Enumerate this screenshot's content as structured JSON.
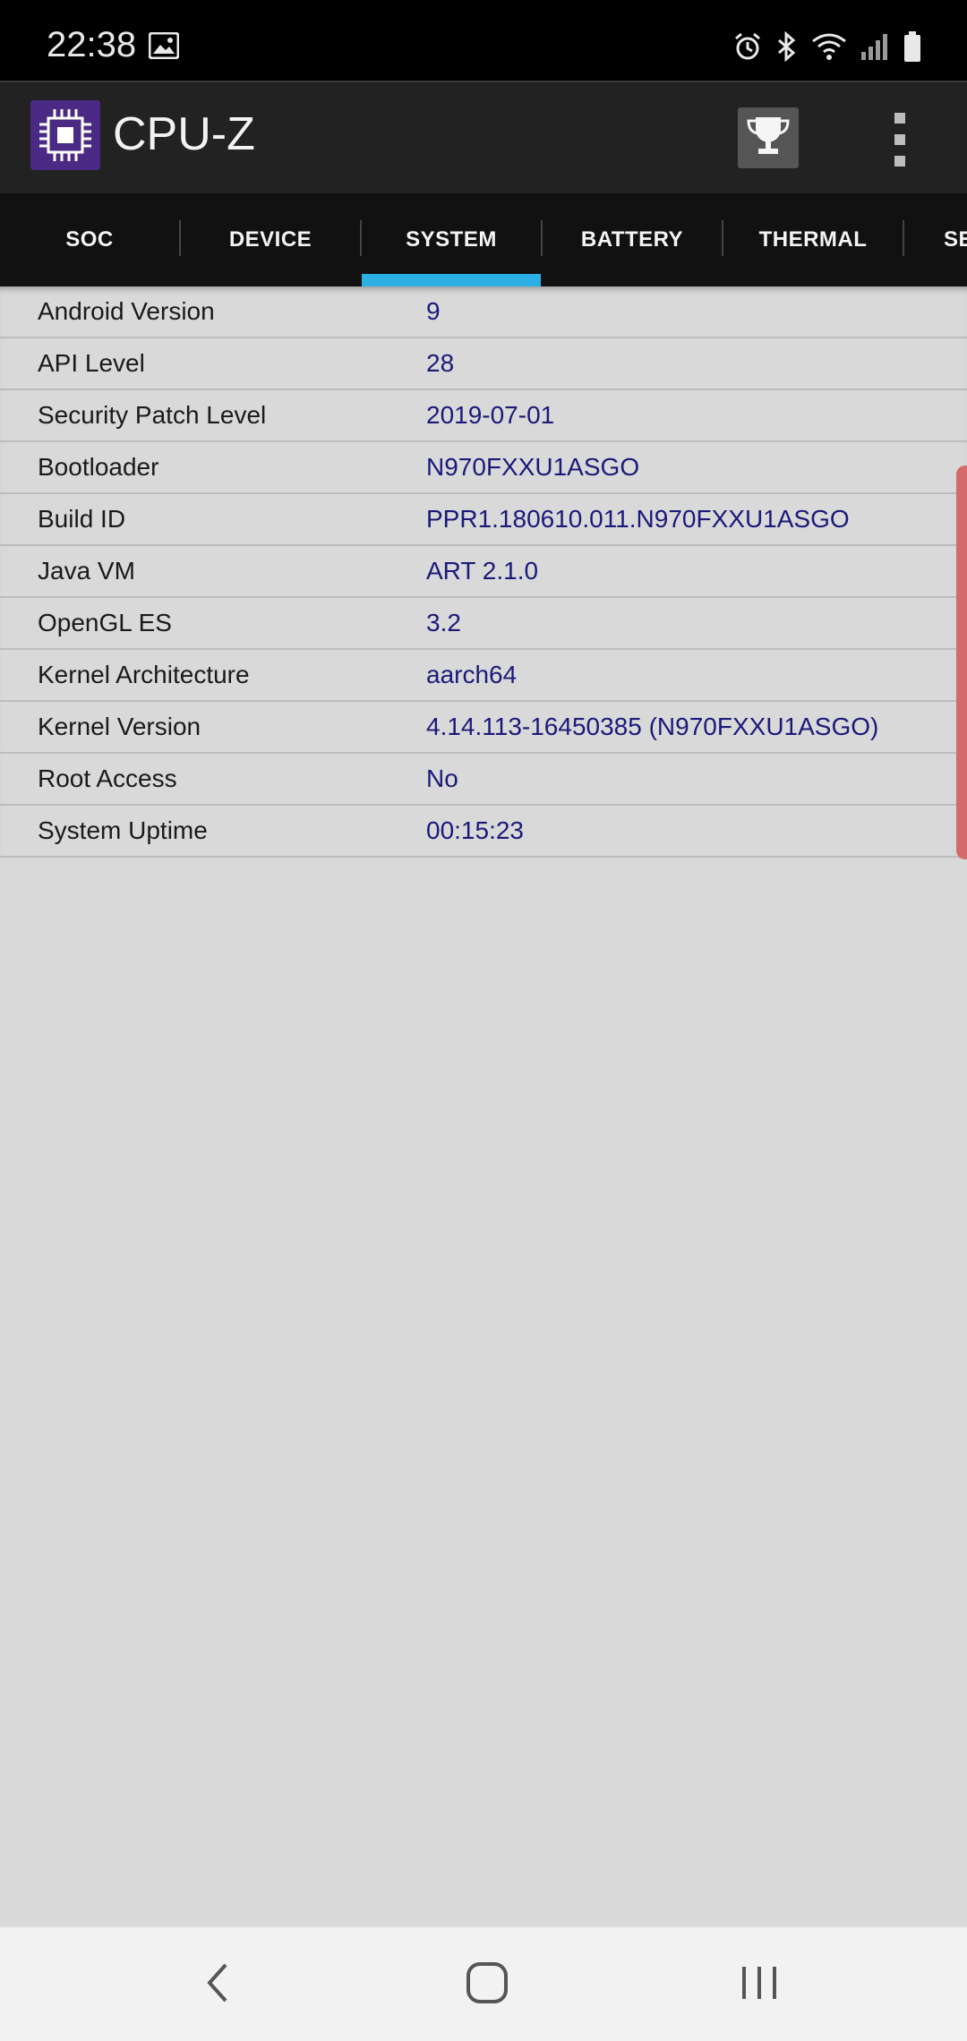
{
  "status_bar": {
    "time": "22:38",
    "icons": [
      "gallery-icon",
      "alarm-icon",
      "bluetooth-icon",
      "wifi-icon",
      "signal-icon",
      "battery-icon"
    ]
  },
  "app_bar": {
    "title": "CPU-Z",
    "logo_icon": "cpu-chip-icon",
    "actions": [
      "trophy-icon",
      "more-vert-icon"
    ]
  },
  "tabs": [
    {
      "label": "SOC",
      "active": false
    },
    {
      "label": "DEVICE",
      "active": false
    },
    {
      "label": "SYSTEM",
      "active": true
    },
    {
      "label": "BATTERY",
      "active": false
    },
    {
      "label": "THERMAL",
      "active": false
    },
    {
      "label": "SE",
      "active": false
    }
  ],
  "system_info": [
    {
      "label": "Android Version",
      "value": "9"
    },
    {
      "label": "API Level",
      "value": "28"
    },
    {
      "label": "Security Patch Level",
      "value": "2019-07-01"
    },
    {
      "label": "Bootloader",
      "value": "N970FXXU1ASGO"
    },
    {
      "label": "Build ID",
      "value": "PPR1.180610.011.N970FXXU1ASGO"
    },
    {
      "label": "Java VM",
      "value": "ART 2.1.0"
    },
    {
      "label": "OpenGL ES",
      "value": "3.2"
    },
    {
      "label": "Kernel Architecture",
      "value": "aarch64"
    },
    {
      "label": "Kernel Version",
      "value": "4.14.113-16450385 (N970FXXU1ASGO)"
    },
    {
      "label": "Root Access",
      "value": "No"
    },
    {
      "label": "System Uptime",
      "value": "00:15:23"
    }
  ],
  "nav_bar": {
    "buttons": [
      "back-icon",
      "home-icon",
      "recents-icon"
    ]
  },
  "colors": {
    "accent": "#2cb0e3",
    "value_text": "#1a1a7a",
    "background": "#d9d9d9",
    "app_bar": "#222222",
    "tab_bar": "#111111"
  }
}
